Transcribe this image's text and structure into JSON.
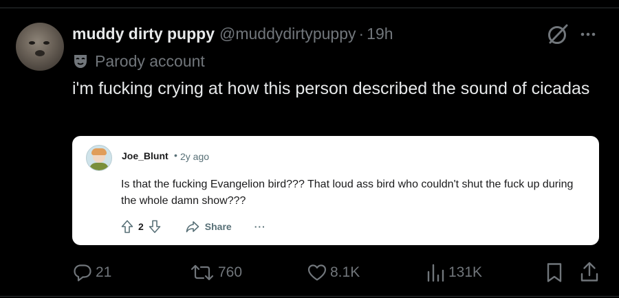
{
  "tweet": {
    "display_name": "muddy dirty puppy",
    "handle": "@muddydirtypuppy",
    "separator": "·",
    "time": "19h",
    "badge_label": "Parody account",
    "text": "i'm fucking crying at how this person described the sound of cicadas"
  },
  "embedded_post": {
    "username": "Joe_Blunt",
    "separator": "•",
    "time": "2y ago",
    "body": "Is that the fucking Evangelion bird??? That loud ass bird who couldn't shut the fuck up during the whole damn show???",
    "vote_count": "2",
    "share_label": "Share",
    "more_label": "···"
  },
  "actions": {
    "replies": "21",
    "reposts": "760",
    "likes": "8.1K",
    "views": "131K"
  },
  "icons": {
    "grok": "grok-icon",
    "more": "more-icon",
    "parody": "theater-mask-icon",
    "reply": "reply-icon",
    "repost": "repost-icon",
    "like": "heart-icon",
    "views": "analytics-icon",
    "bookmark": "bookmark-icon",
    "share": "share-icon"
  },
  "colors": {
    "background": "#000000",
    "primary_text": "#e7e9ea",
    "secondary_text": "#71767b",
    "card_background": "#ffffff"
  }
}
